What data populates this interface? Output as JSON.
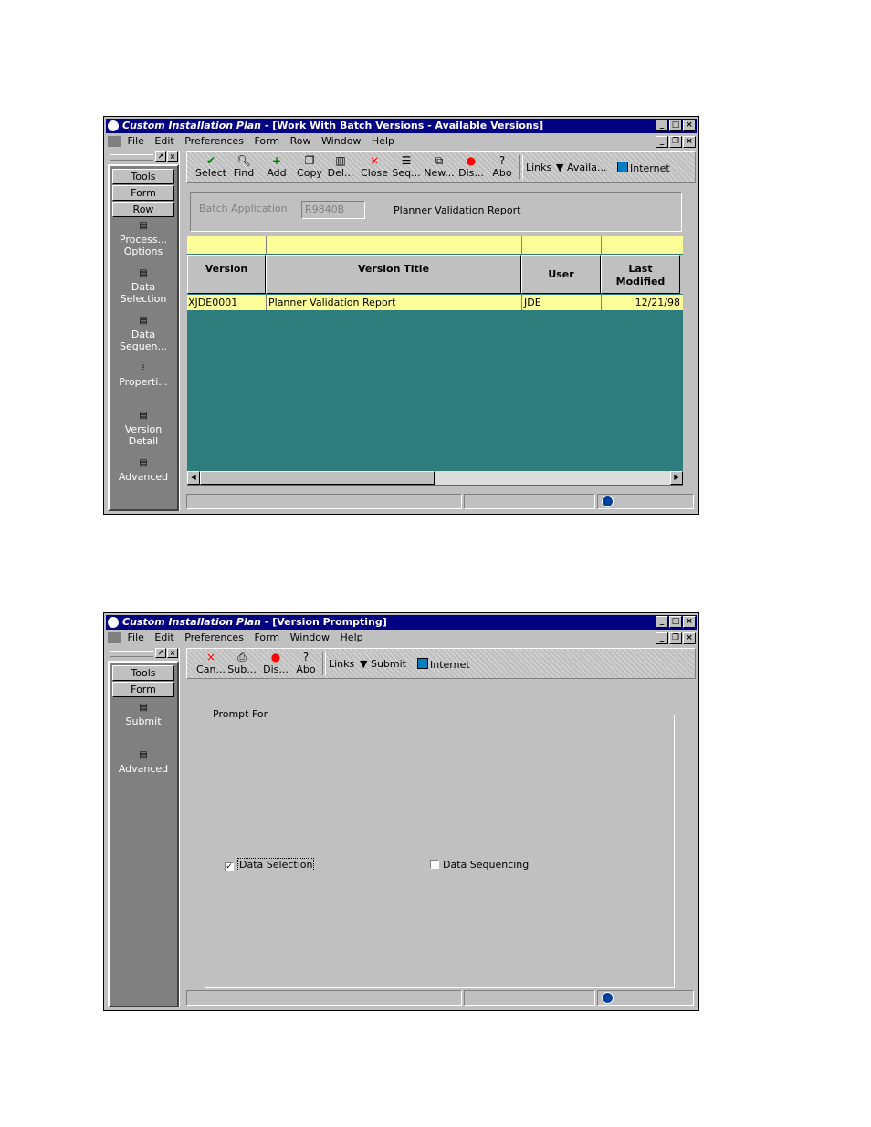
{
  "window1": {
    "app_title": "Custom Installation Plan",
    "form_title": " - [Work With Batch Versions - Available Versions]",
    "menu": [
      "File",
      "Edit",
      "Preferences",
      "Form",
      "Row",
      "Window",
      "Help"
    ],
    "side_buttons": [
      "Tools",
      "Form",
      "Row"
    ],
    "side_items": [
      "Process... Options",
      "Data Selection",
      "Data Sequen...",
      "Properti...",
      "Version Detail",
      "Advanced"
    ],
    "toolbar": [
      "Select",
      "Find",
      "Add",
      "Copy",
      "Del...",
      "Close",
      "Seq...",
      "New...",
      "Dis...",
      "Abo"
    ],
    "links_label": "Links",
    "available_label": "Availa...",
    "internet_label": "Internet",
    "batch_app_label": "Batch Application",
    "batch_app_value": "R9840B",
    "batch_app_desc": "Planner Validation Report",
    "columns": [
      "Version",
      "Version Title",
      "User",
      "Last Modified"
    ],
    "rows": [
      {
        "version": "XJDE0001",
        "title": "Planner Validation Report",
        "user": "JDE",
        "modified": "12/21/98"
      }
    ],
    "colors": {
      "title_bar": "#000080",
      "grid_bg": "#2e7d7d",
      "row_selected": "#ffff99"
    }
  },
  "window2": {
    "app_title": "Custom Installation Plan",
    "form_title": " - [Version Prompting]",
    "menu": [
      "File",
      "Edit",
      "Preferences",
      "Form",
      "Window",
      "Help"
    ],
    "side_buttons": [
      "Tools",
      "Form"
    ],
    "side_items": [
      "Submit",
      "Advanced"
    ],
    "toolbar": [
      "Can...",
      "Sub...",
      "Dis...",
      "Abo"
    ],
    "links_label": "Links",
    "submit_label": "Submit",
    "internet_label": "Internet",
    "group_label": "Prompt For",
    "data_selection": {
      "label": "Data Selection",
      "checked": true
    },
    "data_sequencing": {
      "label": "Data Sequencing",
      "checked": false
    }
  }
}
